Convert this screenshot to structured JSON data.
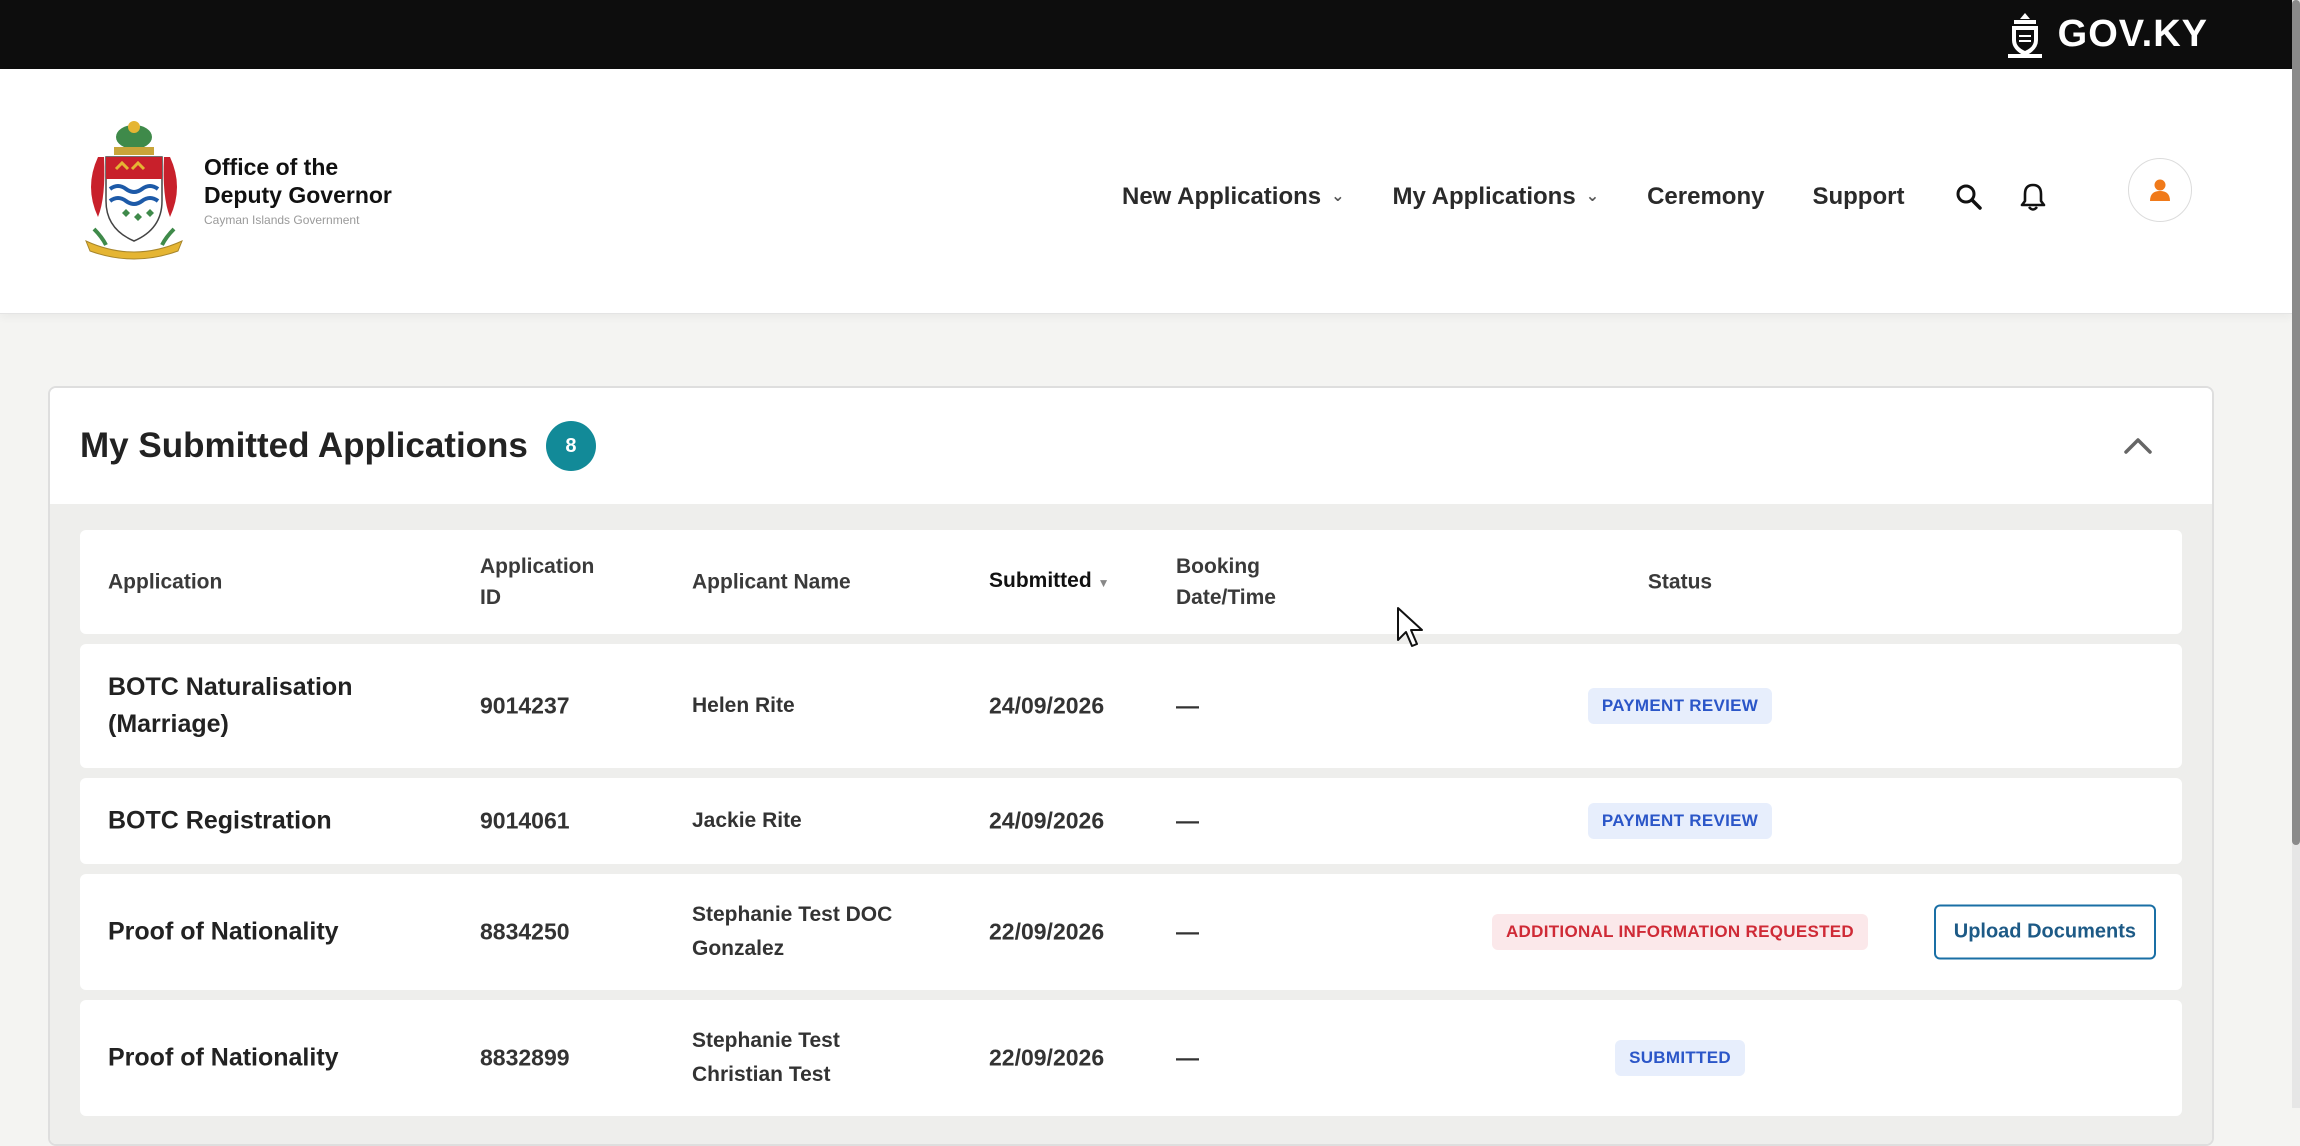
{
  "topbar": {
    "brand": "GOV.KY"
  },
  "header": {
    "logo": {
      "line1": "Office of the",
      "line2": "Deputy Governor",
      "sub": "Cayman Islands Government"
    },
    "nav": [
      {
        "label": "New Applications",
        "has_dropdown": true
      },
      {
        "label": "My Applications",
        "has_dropdown": true
      },
      {
        "label": "Ceremony",
        "has_dropdown": false
      },
      {
        "label": "Support",
        "has_dropdown": false
      }
    ],
    "icons": [
      "search-icon",
      "bell-icon",
      "user-icon"
    ]
  },
  "card": {
    "title": "My Submitted Applications",
    "count": "8",
    "columns": {
      "application": "Application",
      "application_id": "Application ID",
      "applicant_name": "Applicant Name",
      "submitted": "Submitted",
      "booking": "Booking Date/Time",
      "status": "Status"
    },
    "rows": [
      {
        "application": "BOTC Naturalisation (Marriage)",
        "id": "9014237",
        "name": "Helen Rite",
        "submitted": "24/09/2026",
        "booking": "—",
        "status": "PAYMENT REVIEW",
        "action": ""
      },
      {
        "application": "BOTC Registration",
        "id": "9014061",
        "name": "Jackie Rite",
        "submitted": "24/09/2026",
        "booking": "—",
        "status": "PAYMENT REVIEW",
        "action": ""
      },
      {
        "application": "Proof of Nationality",
        "id": "8834250",
        "name": "Stephanie Test DOC Gonzalez",
        "submitted": "22/09/2026",
        "booking": "—",
        "status": "ADDITIONAL INFORMATION REQUESTED",
        "action": "Upload Documents"
      },
      {
        "application": "Proof of Nationality",
        "id": "8832899",
        "name": "Stephanie Test Christian Test",
        "submitted": "22/09/2026",
        "booking": "—",
        "status": "SUBMITTED",
        "action": ""
      }
    ]
  },
  "colors": {
    "accent_teal": "#128a98",
    "status_blue": "#2b56c8",
    "status_red": "#cf2a36",
    "button_border": "#1a6fa5"
  }
}
